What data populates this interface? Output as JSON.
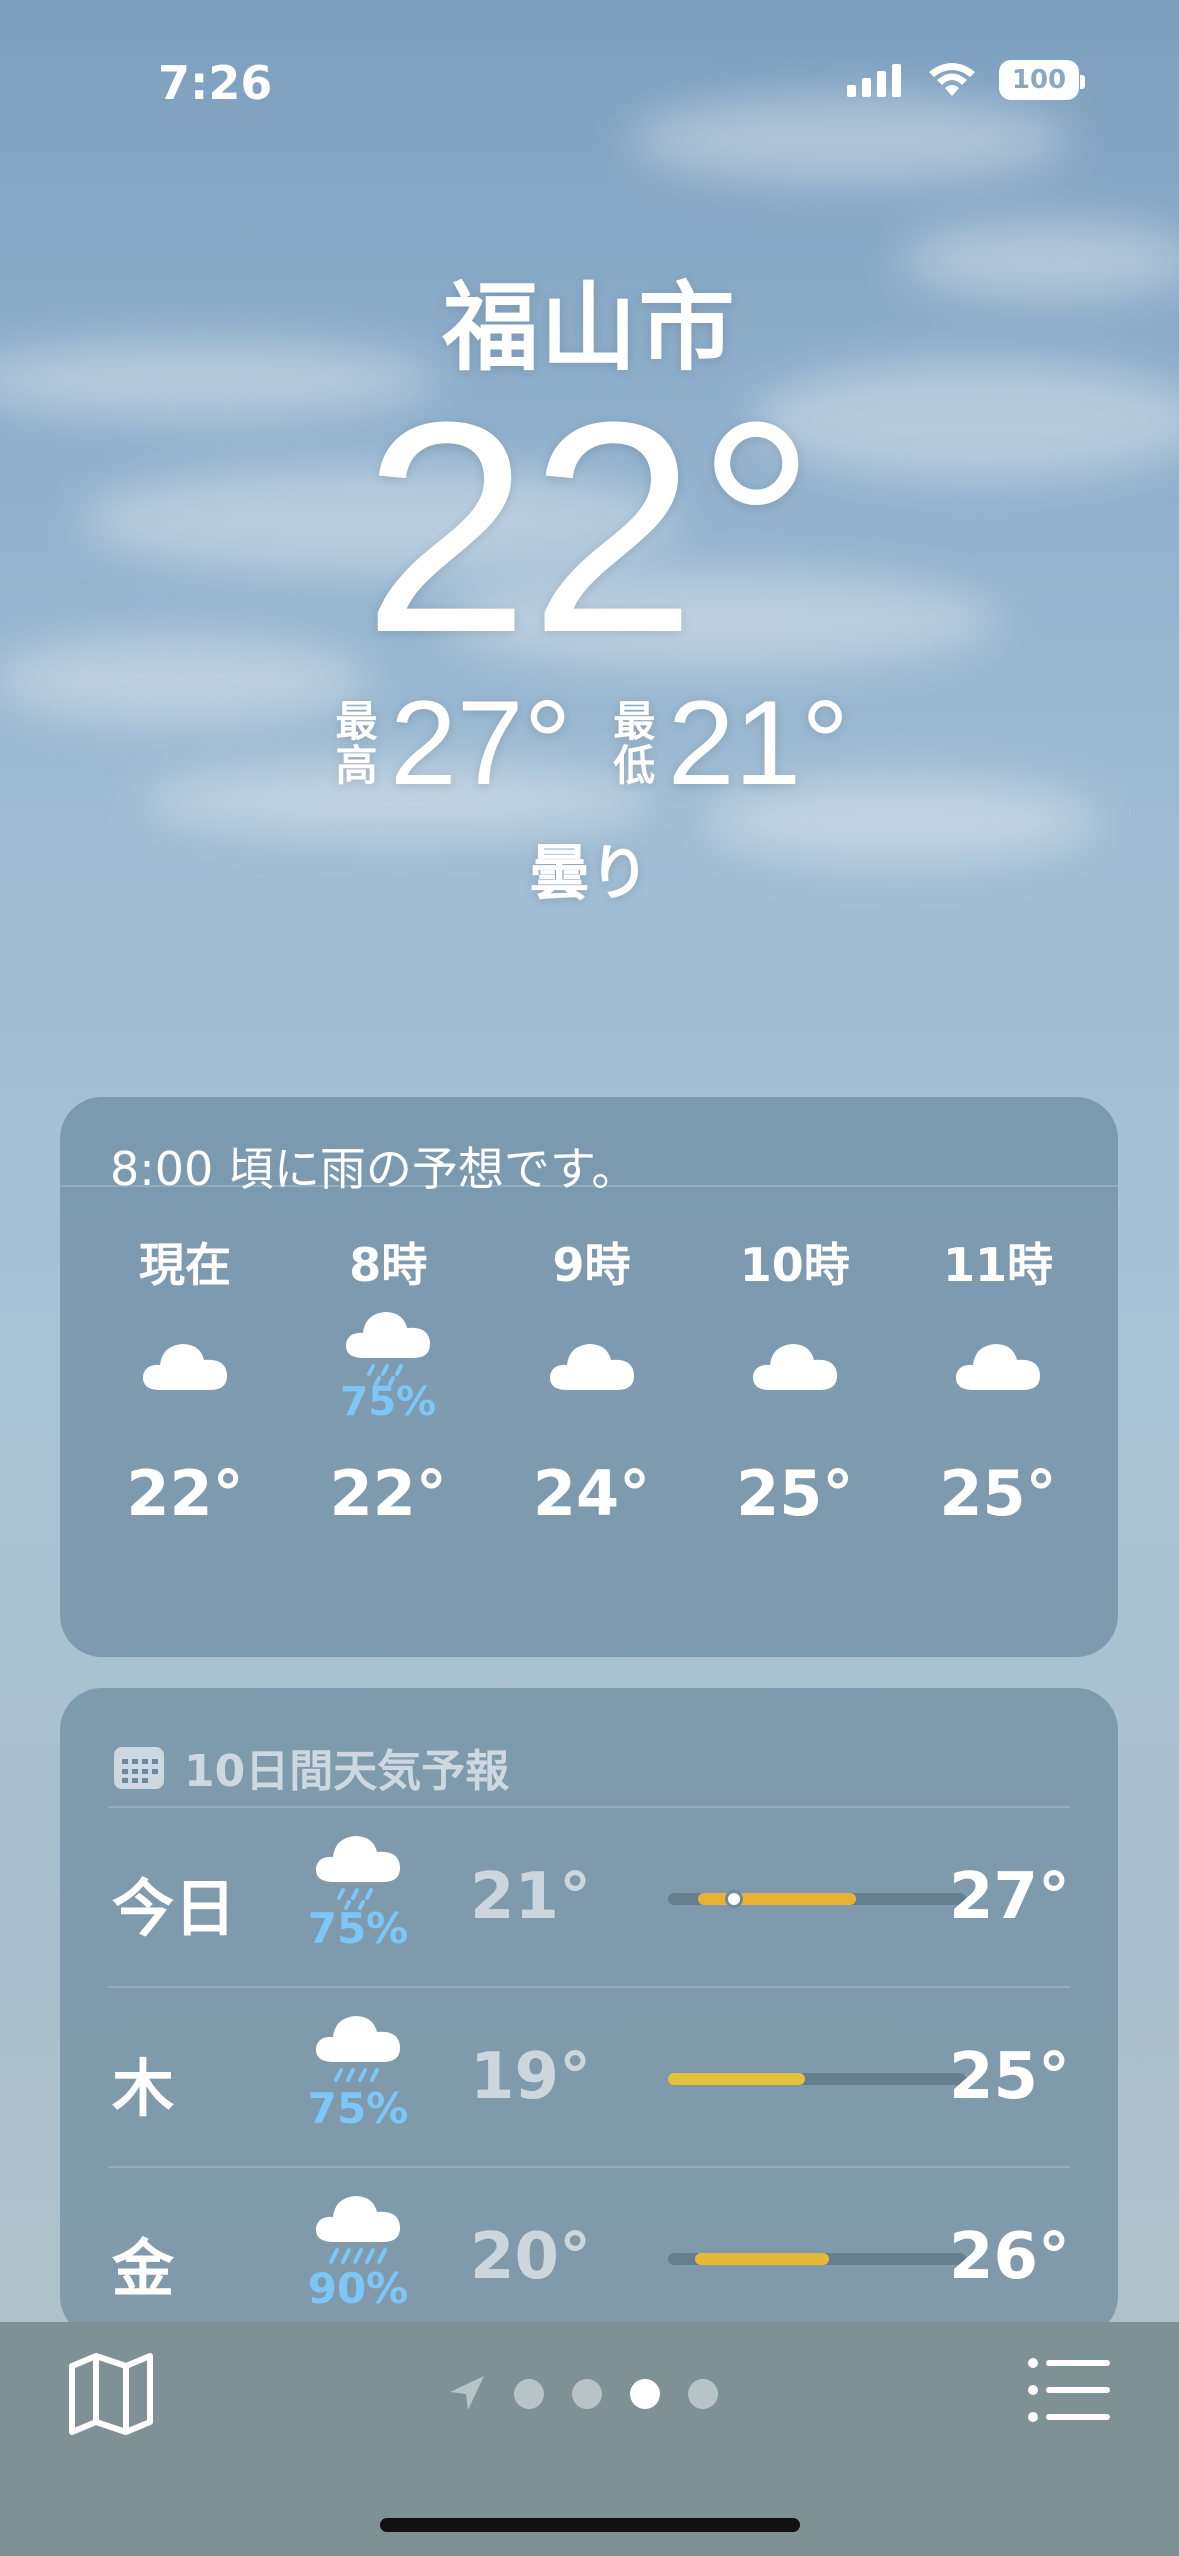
{
  "status": {
    "time": "7:26",
    "battery": "100",
    "icons": [
      "signal-icon",
      "wifi-icon",
      "battery-icon"
    ]
  },
  "header": {
    "city": "福山市",
    "temp": "22°",
    "hi_label": "最高",
    "hi": "27°",
    "lo_label": "最低",
    "lo": "21°",
    "condition": "曇り"
  },
  "hourly": {
    "summary": "8:00 頃に雨の予想です。",
    "items": [
      {
        "label": "現在",
        "icon": "cloud-icon",
        "pct": "",
        "temp": "22°"
      },
      {
        "label": "8時",
        "icon": "cloud-rain-icon",
        "pct": "75%",
        "temp": "22°"
      },
      {
        "label": "9時",
        "icon": "cloud-icon",
        "pct": "",
        "temp": "24°"
      },
      {
        "label": "10時",
        "icon": "cloud-icon",
        "pct": "",
        "temp": "25°"
      },
      {
        "label": "11時",
        "icon": "cloud-icon",
        "pct": "",
        "temp": "25°"
      }
    ]
  },
  "daily": {
    "title": "10日間天気予報",
    "days": [
      {
        "name": "今日",
        "icon": "cloud-rain-icon",
        "pct": "75%",
        "lo": "21°",
        "hi": "27°",
        "bar_start": 0.1,
        "bar_end": 0.63,
        "current": 0.22,
        "color": "#e8b334"
      },
      {
        "name": "木",
        "icon": "cloud-rain-icon",
        "pct": "75%",
        "lo": "19°",
        "hi": "25°",
        "bar_start": 0.0,
        "bar_end": 0.46,
        "color": "#e6c13c"
      },
      {
        "name": "金",
        "icon": "cloud-heavy-rain-icon",
        "pct": "90%",
        "lo": "20°",
        "hi": "26°",
        "bar_start": 0.09,
        "bar_end": 0.54,
        "color": "#e6b835"
      }
    ]
  },
  "tabbar": {
    "pages": 4,
    "active_page": 2
  }
}
